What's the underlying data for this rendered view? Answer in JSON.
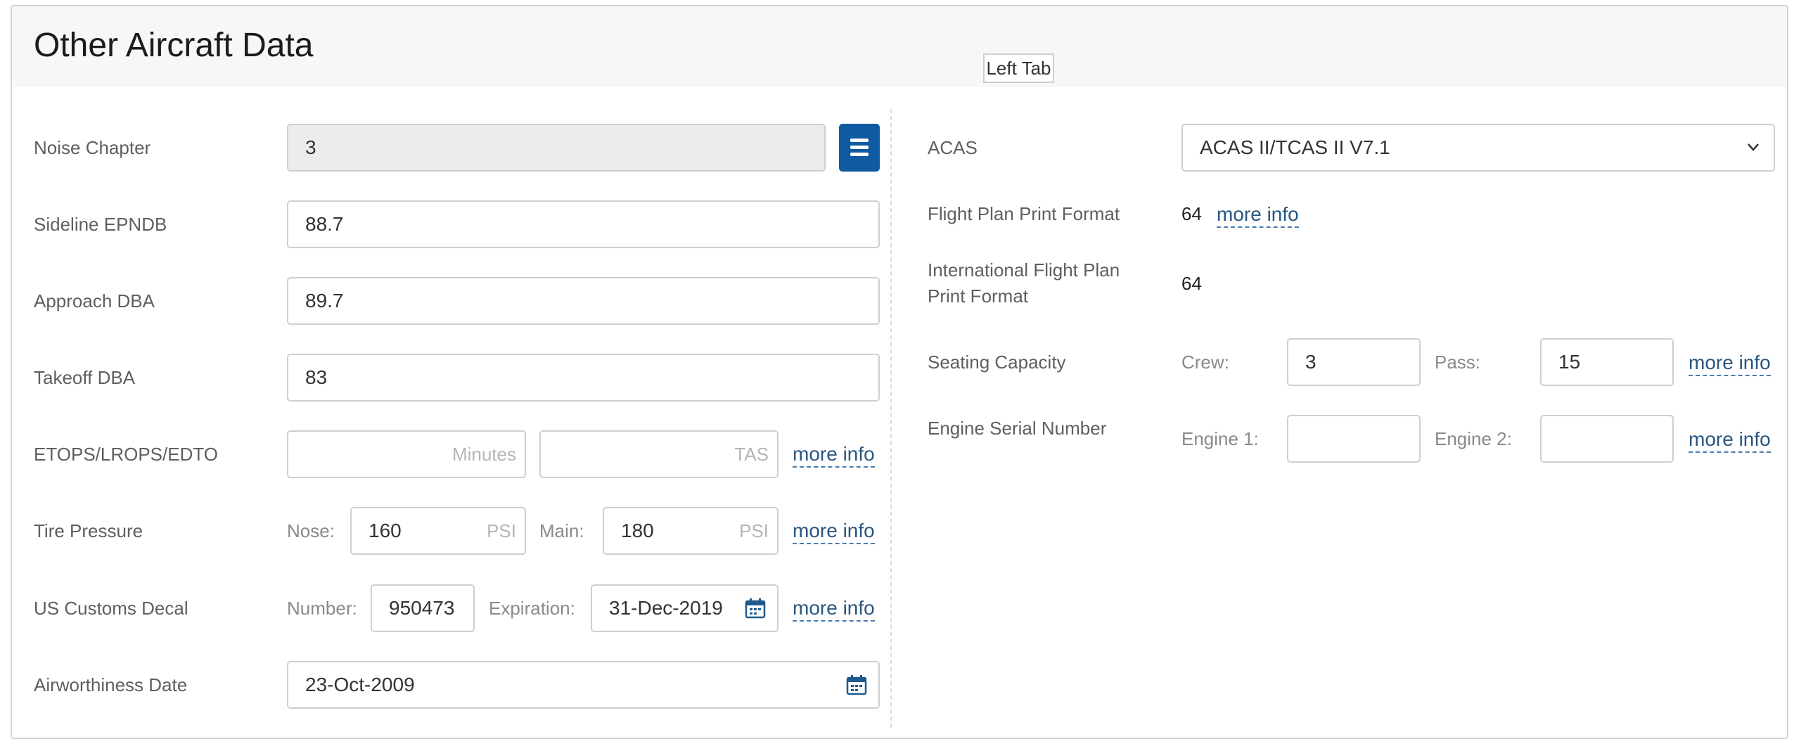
{
  "panel": {
    "title": "Other Aircraft Data"
  },
  "tooltip": "Left Tab",
  "left": {
    "noise_chapter": {
      "label": "Noise Chapter",
      "value": "3"
    },
    "sideline": {
      "label": "Sideline EPNDB",
      "value": "88.7"
    },
    "approach": {
      "label": "Approach DBA",
      "value": "89.7"
    },
    "takeoff": {
      "label": "Takeoff DBA",
      "value": "83"
    },
    "etops": {
      "label": "ETOPS/LROPS/EDTO",
      "minutes_placeholder": "Minutes",
      "tas_placeholder": "TAS",
      "more_info": "more info"
    },
    "tire": {
      "label": "Tire Pressure",
      "nose_label": "Nose:",
      "nose_value": "160",
      "main_label": "Main:",
      "main_value": "180",
      "unit": "PSI",
      "more_info": "more info"
    },
    "customs": {
      "label": "US Customs Decal",
      "number_label": "Number:",
      "number_value": "950473",
      "expiration_label": "Expiration:",
      "expiration_value": "31-Dec-2019",
      "more_info": "more info"
    },
    "airworthiness": {
      "label": "Airworthiness Date",
      "value": "23-Oct-2009"
    }
  },
  "right": {
    "acas": {
      "label": "ACAS",
      "value": "ACAS II/TCAS II V7.1"
    },
    "flight_plan": {
      "label": "Flight Plan Print Format",
      "value": "64",
      "more_info": "more info"
    },
    "intl_flight_plan": {
      "label_line1": "International Flight Plan",
      "label_line2": "Print Format",
      "value": "64"
    },
    "seating": {
      "label": "Seating Capacity",
      "crew_label": "Crew:",
      "crew_value": "3",
      "pass_label": "Pass:",
      "pass_value": "15",
      "more_info": "more info"
    },
    "engine_serial": {
      "label": "Engine Serial Number",
      "engine1_label": "Engine 1:",
      "engine1_value": "",
      "engine2_label": "Engine 2:",
      "engine2_value": "",
      "more_info": "more info"
    }
  },
  "icons": {
    "menu": "hamburger-icon",
    "calendar": "calendar-icon",
    "dropdown": "chevron-down-icon"
  },
  "colors": {
    "primary": "#0f5aa1",
    "link": "#2a5680"
  }
}
